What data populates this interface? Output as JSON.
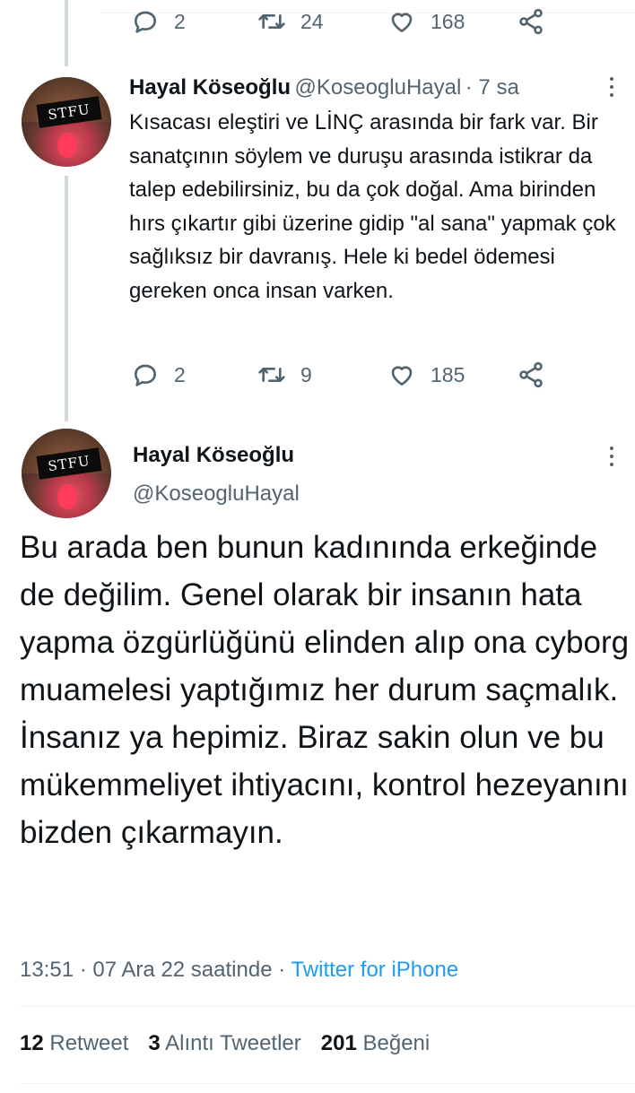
{
  "prev_tweet": {
    "actions": {
      "replies": "2",
      "retweets": "24",
      "likes": "168"
    }
  },
  "reply_tweet": {
    "avatar_text": "STFU",
    "name": "Hayal Köseoğlu",
    "handle": "@KoseogluHayal",
    "time": "· 7 sa",
    "text": "Kısacası eleştiri ve LİNÇ arasında bir fark var. Bir sanatçının söylem ve duruşu arasında istikrar da talep edebilirsiniz, bu da çok doğal. Ama birinden hırs çıkartır gibi üzerine gidip \"al sana\" yapmak çok sağlıksız bir davranış. Hele ki bedel ödemesi gereken onca insan varken.",
    "actions": {
      "replies": "2",
      "retweets": "9",
      "likes": "185"
    }
  },
  "main_tweet": {
    "avatar_text": "STFU",
    "name": "Hayal Köseoğlu",
    "handle": "@KoseogluHayal",
    "text": "Bu arada ben bunun kadınında erkeğinde de değilim. Genel olarak bir insanın hata yapma özgürlüğünü elinden alıp ona cyborg muamelesi yaptığımız her durum saçmalık. İnsanız ya hepimiz. Biraz sakin olun ve bu mükemmeliyet ihtiyacını, kontrol hezeyanını bizden çıkarmayın.",
    "timestamp": "13:51 · 07 Ara 22 saatinde ·",
    "source": "Twitter for iPhone",
    "stats": {
      "retweets_count": "12",
      "retweets_label": "Retweet",
      "quotes_count": "3",
      "quotes_label": "Alıntı Tweetler",
      "likes_count": "201",
      "likes_label": "Beğeni"
    }
  },
  "icons": [
    "reply-icon",
    "retweet-icon",
    "like-icon",
    "share-icon",
    "more-icon"
  ],
  "colors": {
    "text": "#0f1419",
    "muted": "#536471",
    "link": "#1d9bf0",
    "thread_line": "#cfd9de"
  }
}
